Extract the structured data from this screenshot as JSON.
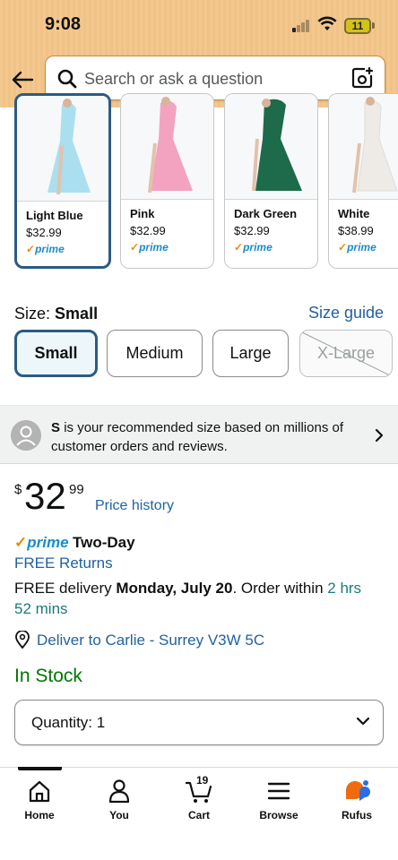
{
  "status_bar": {
    "time": "9:08",
    "battery": "11"
  },
  "search": {
    "placeholder": "Search or ask a question"
  },
  "colors": [
    {
      "name": "Light Blue",
      "price": "$32.99",
      "prime": "prime",
      "selected": true,
      "color": "#aadff0"
    },
    {
      "name": "Pink",
      "price": "$32.99",
      "prime": "prime",
      "selected": false,
      "color": "#f3a3c0"
    },
    {
      "name": "Dark Green",
      "price": "$32.99",
      "prime": "prime",
      "selected": false,
      "color": "#1d6b4a"
    },
    {
      "name": "White",
      "price": "$38.99",
      "prime": "prime",
      "selected": false,
      "color": "#f3f1ef"
    }
  ],
  "size": {
    "label": "Size:",
    "selected": "Small",
    "guide": "Size guide",
    "options": [
      "Small",
      "Medium",
      "Large",
      "X-Large"
    ]
  },
  "recommendation": {
    "size": "S",
    "text": "is your recommended size based on millions of customer orders and reviews."
  },
  "price": {
    "currency": "$",
    "whole": "32",
    "fraction": "99",
    "history": "Price history"
  },
  "prime": {
    "badge": "prime",
    "speed": "Two-Day",
    "returns": "FREE Returns"
  },
  "delivery": {
    "prefix": "FREE delivery",
    "date": "Monday, July 20",
    "middle": ". Order within",
    "countdown": "2 hrs 52 mins"
  },
  "deliver_to": "Deliver to Carlie - Surrey V3W 5C",
  "stock": "In Stock",
  "quantity": "Quantity: 1",
  "nav": {
    "home": "Home",
    "you": "You",
    "cart": "Cart",
    "cart_count": "19",
    "browse": "Browse",
    "rufus": "Rufus"
  },
  "theme": {
    "accent": "#2162a1",
    "prime": "#1a8cc8",
    "header": "#f3c88e",
    "stock": "#007600"
  }
}
